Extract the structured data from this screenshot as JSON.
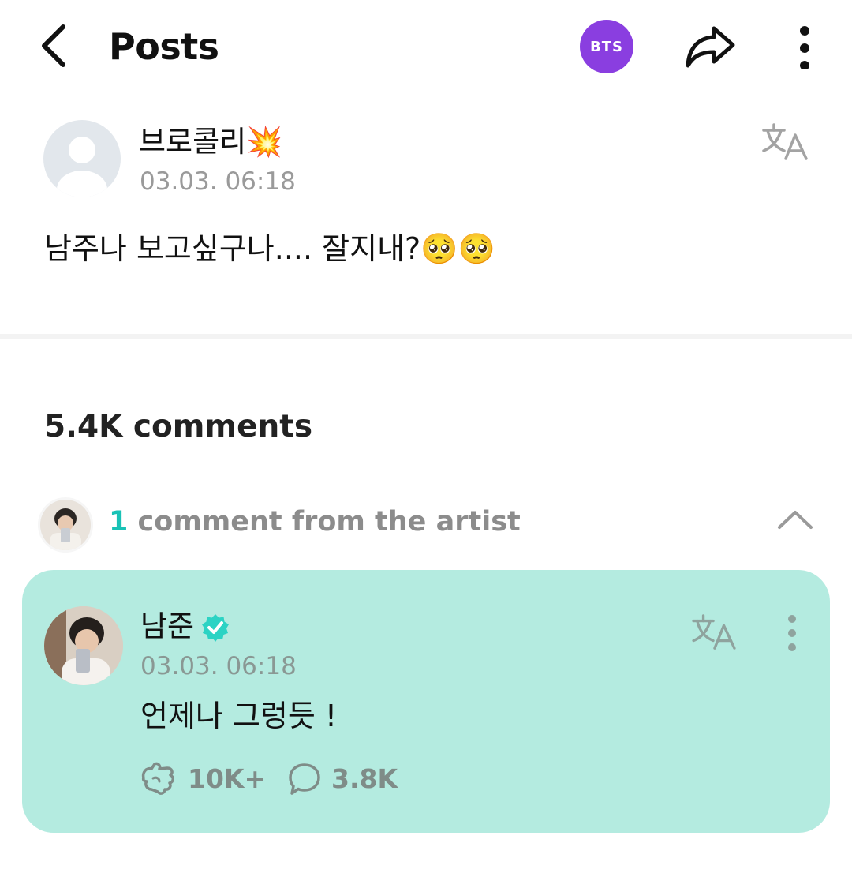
{
  "header": {
    "title": "Posts",
    "community_badge": "BTS",
    "badge_color": "#8a3ee0"
  },
  "post": {
    "author": "브로콜리💥",
    "timestamp": "03.03. 06:18",
    "text": "남주나 보고싶구나.... 잘지내?🥺🥺"
  },
  "comments": {
    "count_label": "5.4K comments",
    "artist_summary": {
      "count": "1",
      "label": "comment from the artist"
    },
    "artist_comment": {
      "name": "남준",
      "timestamp": "03.03. 06:18",
      "text": "언제나 그렁듯 !",
      "likes": "10K+",
      "replies": "3.8K",
      "card_color": "#b4ebe0",
      "accent_color": "#19c2b6"
    }
  },
  "icons": [
    "back-arrow-icon",
    "share-icon",
    "more-vertical-icon",
    "translate-icon",
    "chevron-up-icon",
    "verified-icon",
    "like-icon",
    "comment-icon"
  ]
}
